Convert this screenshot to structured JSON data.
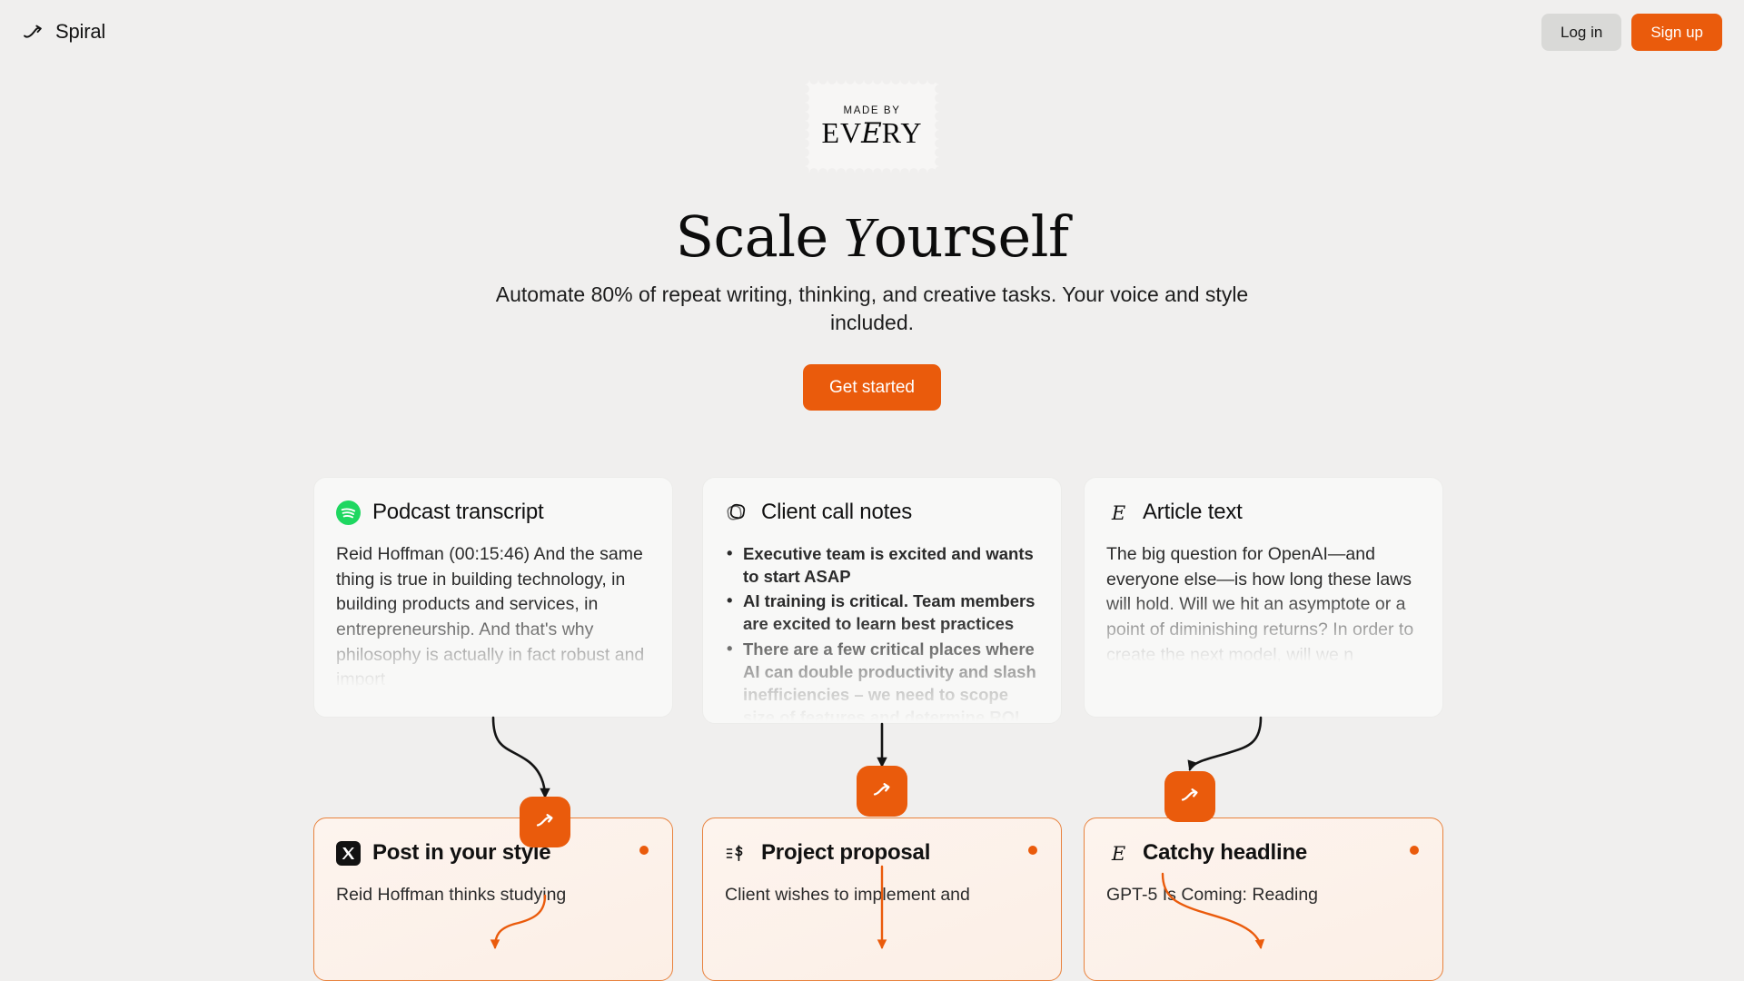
{
  "brand": {
    "name": "Spiral",
    "logo_icon": "spiral-squiggle-icon"
  },
  "header": {
    "login_label": "Log in",
    "signup_label": "Sign up"
  },
  "hero": {
    "stamp_made_by": "MADE BY",
    "stamp_every_pre": "EV",
    "stamp_every_script": "E",
    "stamp_every_post": "RY",
    "title_part1": "Scale",
    "title_script": "Y",
    "title_part2": "ourself",
    "subtitle": "Automate 80% of repeat writing, thinking, and creative tasks. Your voice and style included.",
    "cta_label": "Get started"
  },
  "colors": {
    "accent": "#ea5b0c",
    "page_bg": "#f0efee",
    "card_bg": "#f8f8f7",
    "output_card_bg": "#fdf3ec",
    "output_card_border": "#e8823d",
    "spotify_green": "#1ed760"
  },
  "columns": [
    {
      "input": {
        "icon": "spotify-icon",
        "title": "Podcast transcript",
        "body_type": "paragraph",
        "body": "Reid Hoffman (00:15:46) And the same thing is true in building technology, in building products and services, in entrepreneurship. And that's why philosophy is actually in fact robust and import"
      },
      "connector": {
        "in_style": "curve-right",
        "out_style": "curve-left",
        "badge_icon": "spiral-squiggle-icon"
      },
      "output": {
        "icon": "x-twitter-icon",
        "title": "Post in your style",
        "body": "Reid Hoffman thinks studying"
      }
    },
    {
      "input": {
        "icon": "granola-overlap-icon",
        "title": "Client call notes",
        "body_type": "bullets",
        "bullets": [
          "Executive team is excited and wants to start ASAP",
          "AI training is critical. Team members are excited to learn best practices",
          "There are a few critical places where AI can double productivity and slash inefficiencies – we need to scope size of features and determine ROI"
        ]
      },
      "connector": {
        "in_style": "straight",
        "out_style": "straight",
        "badge_icon": "spiral-squiggle-icon"
      },
      "output": {
        "icon": "invoice-dollar-icon",
        "title": "Project proposal",
        "body": "Client wishes to implement and"
      }
    },
    {
      "input": {
        "icon": "every-script-e-icon",
        "title": "Article text",
        "body_type": "paragraph",
        "body": "The big question for OpenAI—and everyone else—is how long these laws will hold. Will we hit an asymptote or a point of diminishing returns? In order to create the next model, will we n"
      },
      "connector": {
        "in_style": "curve-left",
        "out_style": "curve-right",
        "badge_icon": "spiral-squiggle-icon"
      },
      "output": {
        "icon": "every-script-e-icon",
        "title": "Catchy headline",
        "body": "GPT-5 Is Coming:  Reading"
      }
    }
  ]
}
